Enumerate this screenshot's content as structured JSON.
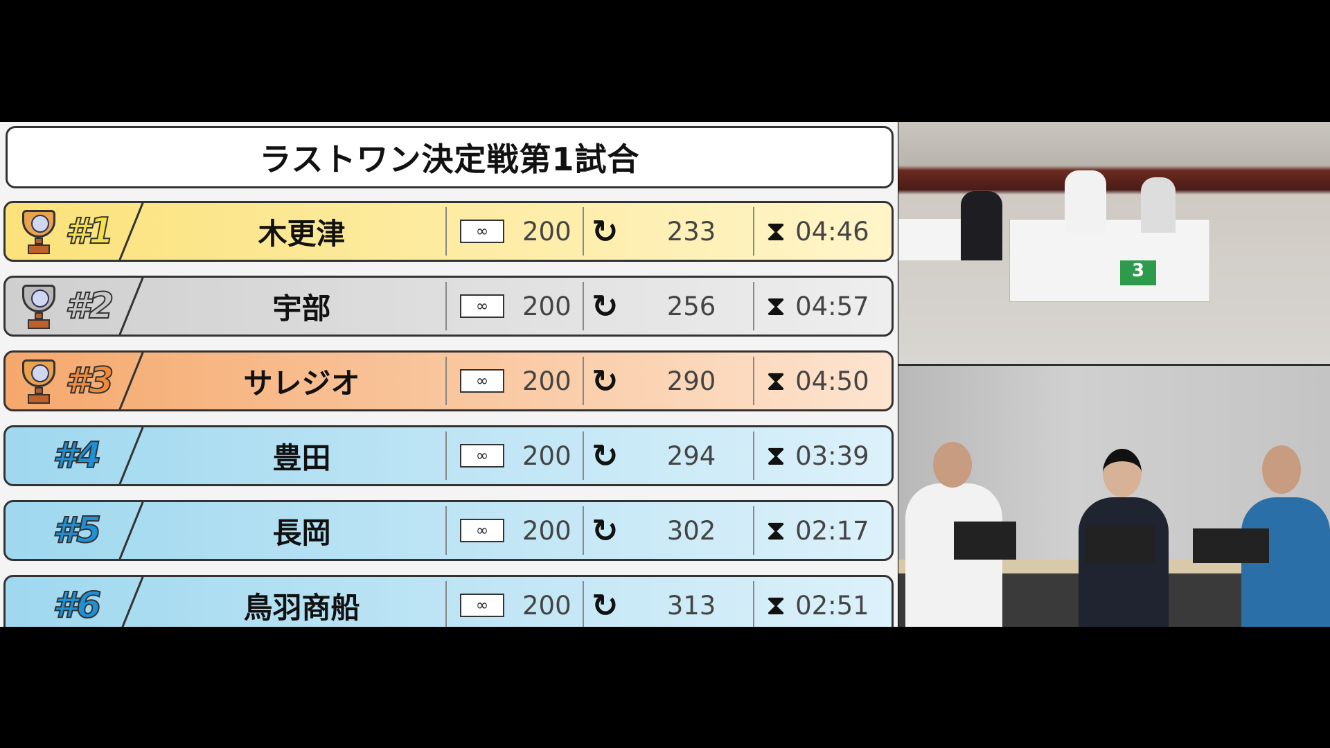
{
  "title": "ラストワン決定戦第1試合",
  "icons": {
    "link": "link-icon",
    "reload": "reload-icon",
    "time": "hourglass-icon",
    "trophy": "trophy-icon"
  },
  "rows": [
    {
      "rank": "#1",
      "name": "木更津",
      "links": "200",
      "turns": "233",
      "time": "04:46",
      "trophy": true,
      "bg": "linear-gradient(90deg,#fbe27a,#fff5c9)",
      "rankColor": "#f6e04a",
      "cup": "#e9a24e"
    },
    {
      "rank": "#2",
      "name": "宇部",
      "links": "200",
      "turns": "256",
      "time": "04:57",
      "trophy": true,
      "bg": "linear-gradient(90deg,#cfcfcf,#eeeeee)",
      "rankColor": "#c9c9c9",
      "cup": "#b8b8b8"
    },
    {
      "rank": "#3",
      "name": "サレジオ",
      "links": "200",
      "turns": "290",
      "time": "04:50",
      "trophy": true,
      "bg": "linear-gradient(90deg,#f5a86c,#fde4cf)",
      "rankColor": "#f08a3a",
      "cup": "#e9a24e"
    },
    {
      "rank": "#4",
      "name": "豊田",
      "links": "200",
      "turns": "294",
      "time": "03:39",
      "trophy": false,
      "bg": "linear-gradient(90deg,#9fd8ef,#dcf1fa)",
      "rankColor": "#1e90d6"
    },
    {
      "rank": "#5",
      "name": "長岡",
      "links": "200",
      "turns": "302",
      "time": "02:17",
      "trophy": false,
      "bg": "linear-gradient(90deg,#9fd8ef,#dcf1fa)",
      "rankColor": "#1e90d6"
    },
    {
      "rank": "#6",
      "name": "鳥羽商船",
      "links": "200",
      "turns": "313",
      "time": "02:51",
      "trophy": false,
      "bg": "linear-gradient(90deg,#9fd8ef,#dcf1fa)",
      "rankColor": "#1e90d6"
    }
  ]
}
